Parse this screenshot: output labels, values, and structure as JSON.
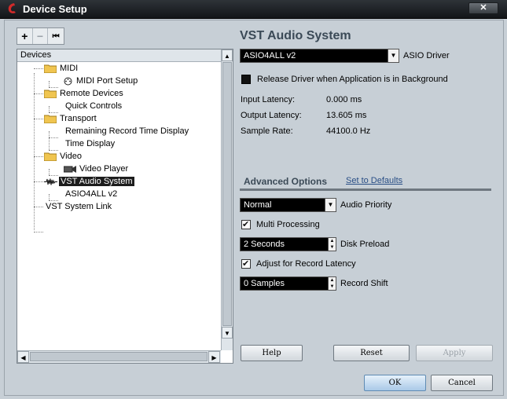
{
  "window": {
    "title": "Device Setup",
    "close_glyph": "✕"
  },
  "toolbar": {
    "add_glyph": "+",
    "remove_glyph": "−",
    "reset_glyph": "⏮"
  },
  "tree": {
    "header": "Devices",
    "items": [
      {
        "label": "MIDI",
        "icon": "folder-icon"
      },
      {
        "label": "MIDI Port Setup",
        "icon": "midi-port-icon"
      },
      {
        "label": "Remote Devices",
        "icon": "folder-icon"
      },
      {
        "label": "Quick Controls",
        "icon": ""
      },
      {
        "label": "Transport",
        "icon": "folder-icon"
      },
      {
        "label": "Remaining Record Time Display",
        "icon": ""
      },
      {
        "label": "Time Display",
        "icon": ""
      },
      {
        "label": "Video",
        "icon": "folder-icon"
      },
      {
        "label": "Video Player",
        "icon": "video-player-icon"
      },
      {
        "label": "VST Audio System",
        "icon": "audio-wave-icon",
        "selected": true
      },
      {
        "label": "ASIO4ALL v2",
        "icon": ""
      },
      {
        "label": "VST System Link",
        "icon": ""
      }
    ]
  },
  "panel": {
    "title": "VST Audio System",
    "driver": {
      "value": "ASIO4ALL v2",
      "label": "ASIO Driver"
    },
    "release_driver": {
      "label": "Release Driver when Application is in Background",
      "checked": false
    },
    "info": [
      {
        "label": "Input Latency:",
        "value": "0.000 ms"
      },
      {
        "label": "Output Latency:",
        "value": "13.605 ms"
      },
      {
        "label": "Sample Rate:",
        "value": "44100.0 Hz"
      }
    ],
    "advanced": {
      "title": "Advanced Options",
      "defaults_link": "Set to Defaults",
      "audio_priority": {
        "value": "Normal",
        "label": "Audio Priority"
      },
      "multi_processing": {
        "label": "Multi Processing",
        "checked": true
      },
      "disk_preload": {
        "value": "2 Seconds",
        "label": "Disk Preload"
      },
      "adjust_latency": {
        "label": "Adjust for Record Latency",
        "checked": true
      },
      "record_shift": {
        "value": "0 Samples",
        "label": "Record Shift"
      }
    }
  },
  "buttons": {
    "help": "Help",
    "reset": "Reset",
    "apply": "Apply",
    "ok": "OK",
    "cancel": "Cancel"
  },
  "glyphs": {
    "dropdown": "▼",
    "spin_up": "▲",
    "spin_down": "▼",
    "scroll_up": "▲",
    "scroll_down": "▼",
    "scroll_left": "◀",
    "scroll_right": "▶"
  },
  "colors": {
    "titlebar": "#1a1e22",
    "panel_bg": "#c7cfd6",
    "accent_title": "#3b4a57",
    "selection": "#1d1d1d"
  }
}
